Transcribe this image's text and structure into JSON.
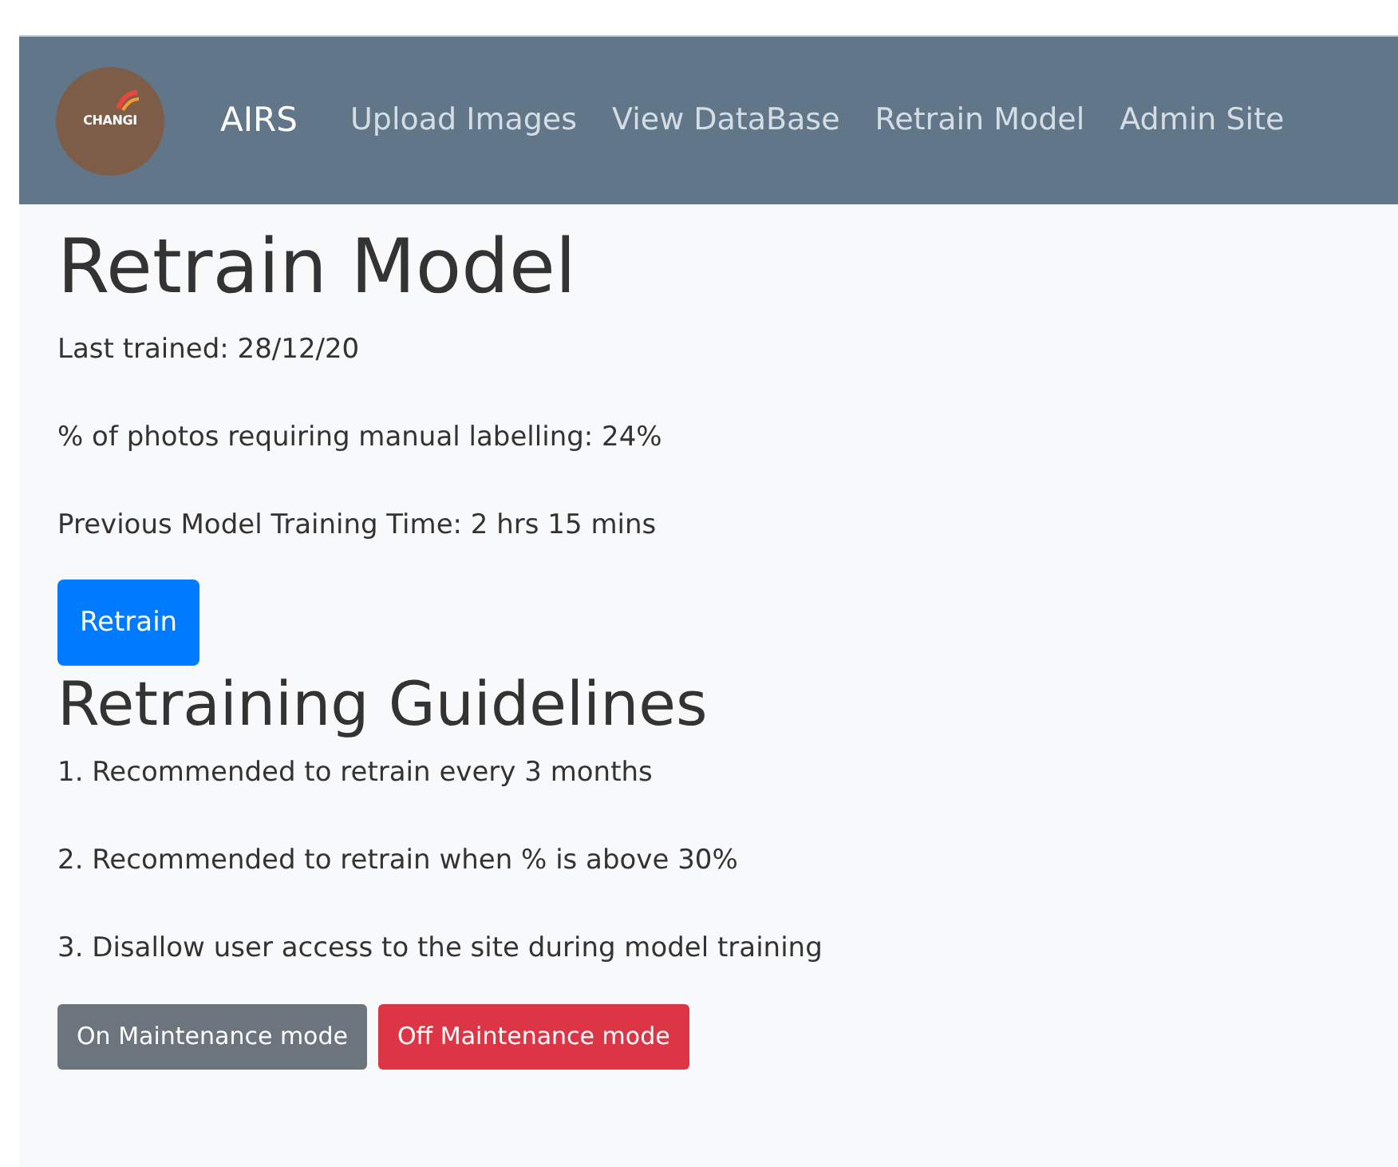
{
  "navbar": {
    "logo_text": "CHANGI",
    "brand": "AIRS",
    "links": [
      "Upload Images",
      "View DataBase",
      "Retrain Model",
      "Admin Site"
    ]
  },
  "title": "Retrain Model",
  "stats": [
    "Last trained: 28/12/20",
    "% of photos requiring manual labelling: 24%",
    "Previous Model Training Time: 2 hrs 15 mins"
  ],
  "retrain_button": "Retrain",
  "guidelines": {
    "heading": "Retraining Guidelines",
    "items": [
      "1. Recommended to retrain every 3 months",
      "2. Recommended to retrain when % is above 30%",
      "3. Disallow user access to the site during model training"
    ]
  },
  "maintenance_buttons": [
    {
      "label": "On Maintenance mode",
      "kind": "secondary"
    },
    {
      "label": "Off Maintenance mode",
      "kind": "danger"
    }
  ]
}
